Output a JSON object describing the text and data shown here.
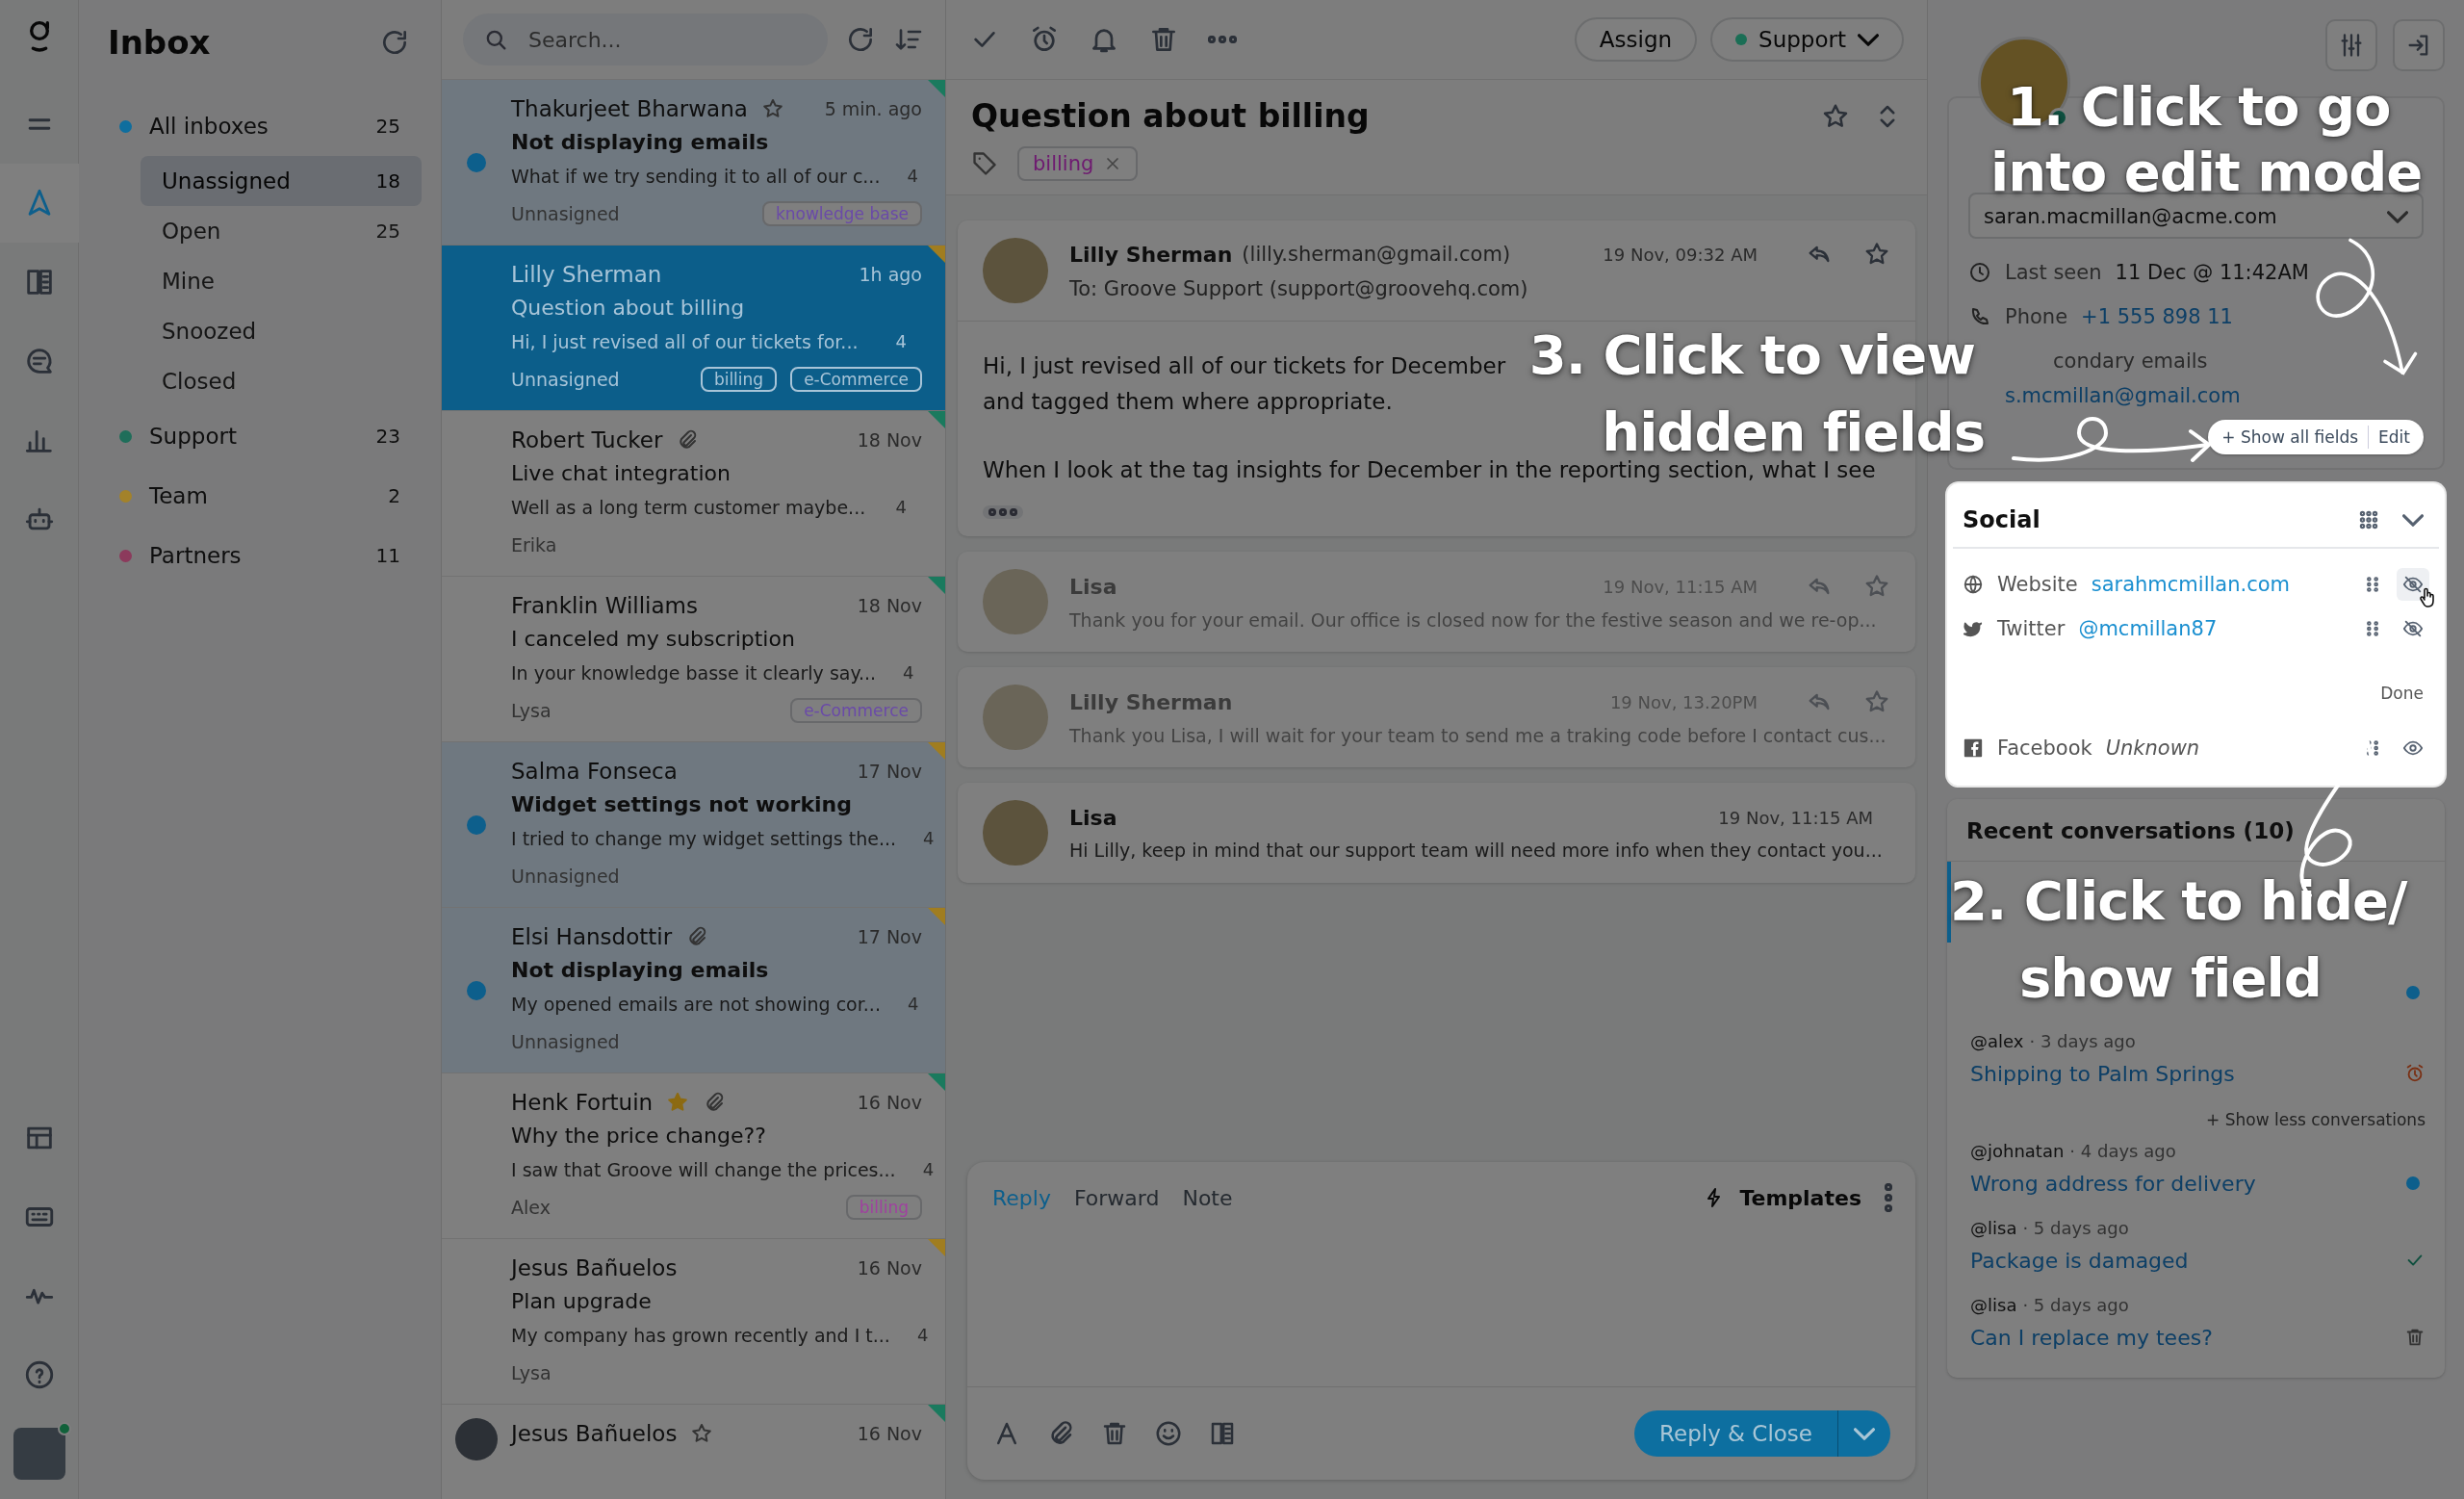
{
  "nav": {
    "items": [
      {
        "selected": false
      },
      {
        "selected": true
      },
      {
        "selected": false
      },
      {
        "selected": false
      },
      {
        "selected": false
      },
      {
        "selected": false
      }
    ],
    "user_online": true
  },
  "sidebar": {
    "title": "Inbox",
    "groups": [
      {
        "label": "All inboxes",
        "count": "25",
        "color": "#0f6e9e",
        "children": [
          {
            "label": "Unassigned",
            "count": "18",
            "selected": true
          },
          {
            "label": "Open",
            "count": "25",
            "selected": false
          },
          {
            "label": "Mine",
            "selected": false
          },
          {
            "label": "Snoozed",
            "selected": false
          },
          {
            "label": "Closed",
            "selected": false
          }
        ]
      },
      {
        "label": "Support",
        "count": "23",
        "color": "#1f6e5a"
      },
      {
        "label": "Team",
        "count": "2",
        "color": "#a3822a"
      },
      {
        "label": "Partners",
        "count": "11",
        "color": "#8c3a5c"
      }
    ]
  },
  "search": {
    "placeholder": "Search..."
  },
  "conversations": [
    {
      "name": "Thakurjeet Bharwana",
      "starred": false,
      "time": "5 min. ago",
      "subject": "Not displaying emails",
      "preview": "What if we try sending it to all of our c...",
      "count": "4",
      "assignee": "Unnasigned",
      "tags": [
        {
          "label": "knowledge base",
          "color": "#6a4aa8"
        }
      ],
      "unread": true,
      "selected": false,
      "color": "#1a7a5e"
    },
    {
      "name": "Lilly Sherman",
      "time": "1h ago",
      "subject": "Question about billing",
      "preview": "Hi, I just revised all of our tickets for...",
      "count": "4",
      "assignee": "Unnasigned",
      "tags": [
        {
          "label": "billing"
        },
        {
          "label": "e-Commerce"
        }
      ],
      "unread": false,
      "selected": true,
      "color": "#a07d20"
    },
    {
      "name": "Robert Tucker",
      "attachment": true,
      "time": "18 Nov",
      "subject": "Live chat integration",
      "preview": "Well as a long term customer maybe...",
      "count": "4",
      "assignee": "Erika",
      "unread": false,
      "selected": false,
      "color": "#1a7a5e"
    },
    {
      "name": "Franklin Williams",
      "time": "18 Nov",
      "subject": "I canceled my subscription",
      "preview": "In your knowledge basse it clearly say...",
      "count": "4",
      "assignee": "Lysa",
      "tags": [
        {
          "label": "e-Commerce",
          "color": "#6a4aa8"
        }
      ],
      "unread": false,
      "selected": false,
      "color": "#1a7a5e"
    },
    {
      "name": "Salma Fonseca",
      "time": "17 Nov",
      "subject": "Widget settings not working",
      "preview": "I tried to change my widget settings the...",
      "count": "4",
      "assignee": "Unnasigned",
      "unread": true,
      "selected": false,
      "color": "#a07d20"
    },
    {
      "name": "Elsi Hansdottir",
      "attachment": true,
      "time": "17 Nov",
      "subject": "Not displaying emails",
      "preview": "My opened emails are not showing cor...",
      "count": "4",
      "assignee": "Unnasigned",
      "unread": true,
      "selected": false,
      "color": "#a07d20"
    },
    {
      "name": "Henk Fortuin",
      "starred": true,
      "attachment": true,
      "time": "16 Nov",
      "subject": "Why the price change??",
      "preview": "I saw that Groove will change the prices...",
      "count": "4",
      "assignee": "Alex",
      "tags": [
        {
          "label": "billing",
          "color": "#a040a0"
        }
      ],
      "unread": false,
      "selected": false,
      "color": "#1a7a5e"
    },
    {
      "name": "Jesus Bañuelos",
      "time": "16 Nov",
      "subject": "Plan upgrade",
      "preview": "My company has grown recently and I t...",
      "count": "4",
      "assignee": "Lysa",
      "unread": false,
      "selected": false,
      "color": "#a07d20"
    },
    {
      "name": "Jesus Bañuelos",
      "starred": false,
      "time": "16 Nov",
      "avatar": true,
      "unread": false,
      "selected": false,
      "color": "#1a7a5e"
    }
  ],
  "toolbar": {
    "assign": "Assign",
    "mailbox": {
      "label": "Support",
      "color": "#1a6e55"
    }
  },
  "ticket": {
    "title": "Question about billing",
    "tags": [
      {
        "label": "billing",
        "color": "#6e1a70"
      }
    ]
  },
  "messages": [
    {
      "kind": "expanded",
      "name": "Lilly Sherman",
      "email": "(lilly.sherman@gmail.com)",
      "time": "19 Nov, 09:32 AM",
      "to": "To: Groove Support (support@groovehq.com)",
      "body": [
        "Hi, I just revised all of our tickets for December and tagged them where appropriate.",
        "When I look at the tag insights for December in the reporting section, what I see"
      ],
      "faded": false
    },
    {
      "kind": "collapsed",
      "name": "Lisa",
      "time": "19 Nov, 11:15 AM",
      "preview": "Thank you for your email. Our office is closed now for the festive season and we re-op...",
      "faded": true
    },
    {
      "kind": "collapsed",
      "name": "Lilly Sherman",
      "time": "19 Nov, 13.20PM",
      "preview": "Thank you Lisa, I will wait for your team to send me a traking code before I contact cus...",
      "faded": true
    },
    {
      "kind": "note",
      "name": "Lisa",
      "time": "19 Nov, 11:15 AM",
      "preview": "Hi Lilly, keep in mind that our support team will need more info when they contact you...",
      "faded": false
    }
  ],
  "composer": {
    "tabs": [
      {
        "label": "Reply",
        "selected": true
      },
      {
        "label": "Forward",
        "selected": false
      },
      {
        "label": "Note",
        "selected": false
      }
    ],
    "templates": "Templates",
    "send": "Reply & Close"
  },
  "contact": {
    "online": true,
    "email": "saran.macmillan@acme.com",
    "fields": [
      {
        "kind": "last_seen",
        "label": "Last seen",
        "value": "11 Dec @ 11:42AM"
      },
      {
        "kind": "phone",
        "label": "Phone",
        "value": "+1 555 898 11"
      }
    ],
    "secondary_label": "condary emails",
    "secondary_email": "s.mcmillan@gmail.com",
    "show_all": "+ Show all fields",
    "edit": "Edit"
  },
  "social": {
    "title": "Social",
    "fields": [
      {
        "kind": "globe",
        "label": "Website",
        "value": "sarahmcmillan.com",
        "hidden": true,
        "hovered": true
      },
      {
        "kind": "bird",
        "label": "Twitter",
        "value": "@mcmillan87",
        "hidden": true,
        "hovered": false
      },
      {
        "kind": "done",
        "label": "Done"
      },
      {
        "kind": "facebook",
        "label": "Facebook",
        "value": "Unknown",
        "hidden": false,
        "hovered": false,
        "unknown": true
      }
    ]
  },
  "recent": {
    "title": "Recent conversations (10)",
    "items": [
      {
        "kind": "plain",
        "selected": true
      },
      {
        "kind": "open",
        "selected": false
      },
      {
        "kind": "snoozed",
        "who": "@alex",
        "when": "· 3 days ago",
        "title": "Shipping to Palm Springs",
        "selected": false
      },
      {
        "kind": "toggle",
        "label": "+ Show less conversations"
      },
      {
        "kind": "open",
        "who": "@johnatan",
        "when": "· 4 days ago",
        "title": "Wrong address for delivery",
        "selected": false
      },
      {
        "kind": "closed",
        "who": "@lisa",
        "when": "· 5 days ago",
        "title": "Package is damaged",
        "selected": false
      },
      {
        "kind": "deleted",
        "who": "@lisa",
        "when": "· 5 days ago",
        "title": "Can I replace my tees?",
        "selected": false
      }
    ]
  },
  "annotations": [
    {
      "lines": [
        "1. Click to go",
        "into edit mode"
      ]
    },
    {
      "lines": [
        "3. Click to view",
        "hidden fields"
      ]
    },
    {
      "lines": [
        "2. Click to hide/",
        "show field"
      ]
    }
  ]
}
